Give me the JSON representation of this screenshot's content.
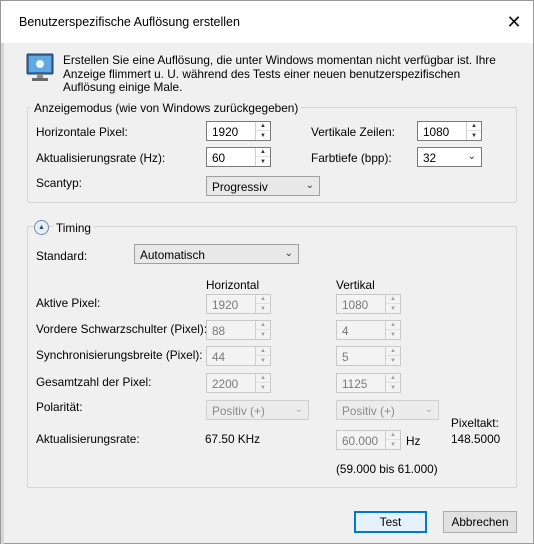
{
  "window": {
    "title": "Benutzerspezifische Auflösung erstellen"
  },
  "icons": {
    "close": "close-icon",
    "monitor": "monitor-icon"
  },
  "info": {
    "text": "Erstellen Sie eine Auflösung, die unter Windows momentan nicht verfügbar ist. Ihre Anzeige flimmert u. U. während des Tests einer neuen benutzerspezifischen Auflösung einige Male."
  },
  "display_mode": {
    "group_label": "Anzeigemodus (wie von Windows zurückgegeben)",
    "horizontal_pixels_label": "Horizontale Pixel:",
    "horizontal_pixels_value": "1920",
    "vertical_lines_label": "Vertikale Zeilen:",
    "vertical_lines_value": "1080",
    "refresh_rate_label": "Aktualisierungsrate (Hz):",
    "refresh_rate_value": "60",
    "color_depth_label": "Farbtiefe (bpp):",
    "color_depth_value": "32",
    "scan_type_label": "Scantyp:",
    "scan_type_value": "Progressiv"
  },
  "timing": {
    "label": "Timing",
    "standard_label": "Standard:",
    "standard_value": "Automatisch",
    "col_horizontal": "Horizontal",
    "col_vertical": "Vertikal",
    "rows": [
      {
        "label": "Aktive Pixel:",
        "h": "1920",
        "v": "1080"
      },
      {
        "label": "Vordere Schwarzschulter (Pixel):",
        "h": "88",
        "v": "4"
      },
      {
        "label": "Synchronisierungsbreite (Pixel):",
        "h": "44",
        "v": "5"
      },
      {
        "label": "Gesamtzahl der Pixel:",
        "h": "2200",
        "v": "1125"
      }
    ],
    "polarity_label": "Polarität:",
    "polarity_h": "Positiv (+)",
    "polarity_v": "Positiv (+)",
    "refresh_label": "Aktualisierungsrate:",
    "refresh_h": "67.50 KHz",
    "refresh_v": "60.000",
    "refresh_unit": "Hz",
    "refresh_range": "(59.000 bis 61.000)",
    "pixel_clock_label": "Pixeltakt:",
    "pixel_clock_value": "148.5000"
  },
  "buttons": {
    "test": "Test",
    "cancel": "Abbrechen"
  }
}
